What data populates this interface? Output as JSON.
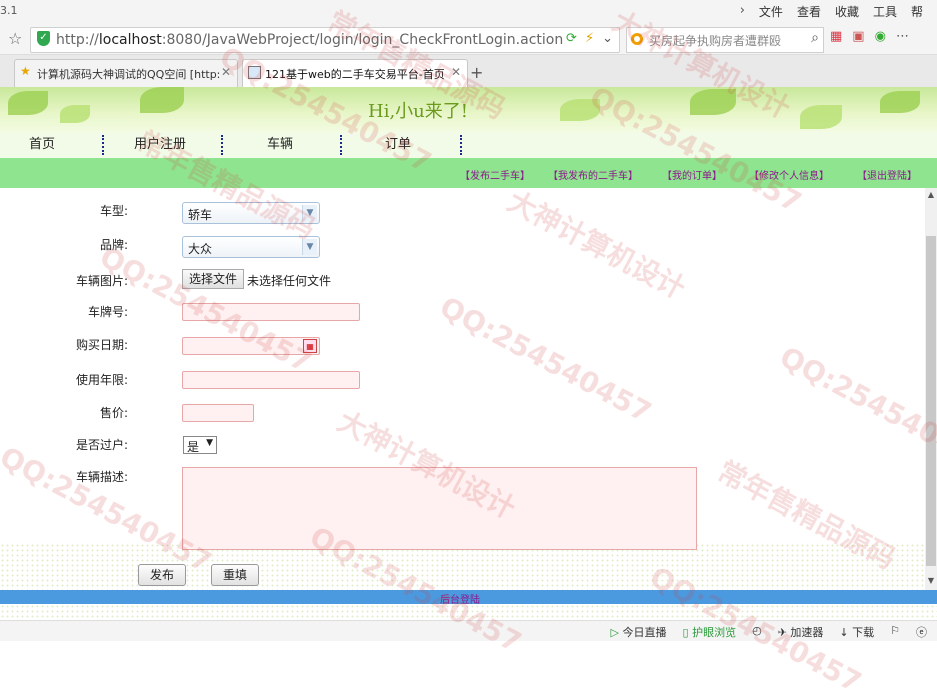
{
  "browser": {
    "version_fragment": "3.1",
    "menu": [
      "文件",
      "查看",
      "收藏",
      "工具",
      "帮"
    ],
    "url_host": "localhost",
    "url_prefix": "http://",
    "url_rest": ":8080/JavaWebProject/login/login_CheckFrontLogin.action",
    "search_placeholder": "买房起争执购房者遭群殴",
    "tabs": [
      {
        "label": "计算机源码大神调试的QQ空间 [http:",
        "active": false
      },
      {
        "label": "121基于web的二手车交易平台-首页",
        "active": true
      }
    ]
  },
  "header": {
    "greeting": "Hi,小u来了!"
  },
  "nav": {
    "items": [
      "首页",
      "用户注册",
      "车辆",
      "订单"
    ]
  },
  "subnav": {
    "links": [
      "【发布二手车】",
      "【我发布的二手车】",
      "【我的订单】",
      "【修改个人信息】",
      "【退出登陆】"
    ]
  },
  "form": {
    "type_label": "车型:",
    "type_value": "轿车",
    "brand_label": "品牌:",
    "brand_value": "大众",
    "image_label": "车辆图片:",
    "file_button": "选择文件",
    "file_status": "未选择任何文件",
    "plate_label": "车牌号:",
    "buy_date_label": "购买日期:",
    "years_label": "使用年限:",
    "price_label": "售价:",
    "transfer_label": "是否过户:",
    "transfer_value": "是",
    "desc_label": "车辆描述:",
    "submit_label": "发布",
    "reset_label": "重填"
  },
  "footer": {
    "admin_link": "后台登陆"
  },
  "statusbar": {
    "items": [
      "今日直播",
      "护眼浏览",
      "加速器",
      "下载"
    ]
  },
  "watermark": {
    "lines": [
      "大神计算机设计",
      "QQ:254540457",
      "常年售精品源码"
    ]
  },
  "colors": {
    "nav_bg": "#f1fbe8",
    "subnav_bg": "#8fe48f",
    "link_purple": "#8b1a8b",
    "footer_blue": "#4b9ae0",
    "input_bg": "#fff1f1"
  }
}
